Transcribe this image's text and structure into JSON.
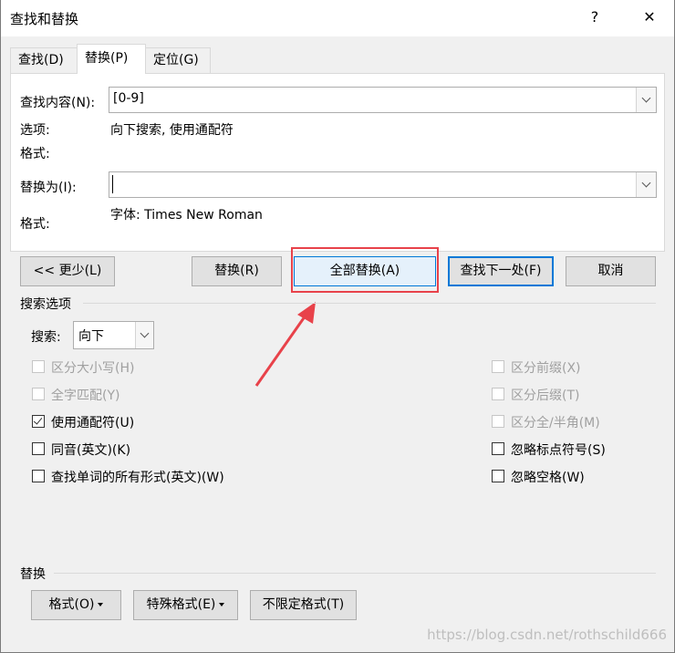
{
  "window": {
    "title": "查找和替换",
    "help_label": "?",
    "close_label": "✕"
  },
  "tabs": [
    {
      "label": "查找(D)"
    },
    {
      "label": "替换(P)"
    },
    {
      "label": "定位(G)"
    }
  ],
  "find": {
    "label": "查找内容(N):",
    "value": "[0-9]",
    "options_label": "选项:",
    "options_value": "向下搜索, 使用通配符",
    "format_label": "格式:"
  },
  "replace": {
    "label": "替换为(I):",
    "value": "",
    "format_label": "格式:",
    "format_value": "字体: Times New Roman"
  },
  "buttons": {
    "less": "<< 更少(L)",
    "replace": "替换(R)",
    "replace_all": "全部替换(A)",
    "find_next": "查找下一处(F)",
    "cancel": "取消"
  },
  "search_options": {
    "heading": "搜索选项",
    "search_label": "搜索:",
    "search_value": "向下",
    "left": [
      {
        "label": "区分大小写(H)",
        "checked": false,
        "disabled": true
      },
      {
        "label": "全字匹配(Y)",
        "checked": false,
        "disabled": true
      },
      {
        "label": "使用通配符(U)",
        "checked": true,
        "disabled": false
      },
      {
        "label": "同音(英文)(K)",
        "checked": false,
        "disabled": false
      },
      {
        "label": "查找单词的所有形式(英文)(W)",
        "checked": false,
        "disabled": false
      }
    ],
    "right": [
      {
        "label": "区分前缀(X)",
        "checked": false,
        "disabled": true
      },
      {
        "label": "区分后缀(T)",
        "checked": false,
        "disabled": true
      },
      {
        "label": "区分全/半角(M)",
        "checked": false,
        "disabled": true
      },
      {
        "label": "忽略标点符号(S)",
        "checked": false,
        "disabled": false
      },
      {
        "label": "忽略空格(W)",
        "checked": false,
        "disabled": false
      }
    ]
  },
  "replace_section": {
    "heading": "替换",
    "format_button": "格式(O)",
    "special_button": "特殊格式(E)",
    "no_format_button": "不限定格式(T)"
  },
  "watermark": "https://blog.csdn.net/rothschild666",
  "colors": {
    "accent": "#0078d7",
    "annotation": "#e8424a",
    "dialog_bg": "#f0f0f0"
  }
}
